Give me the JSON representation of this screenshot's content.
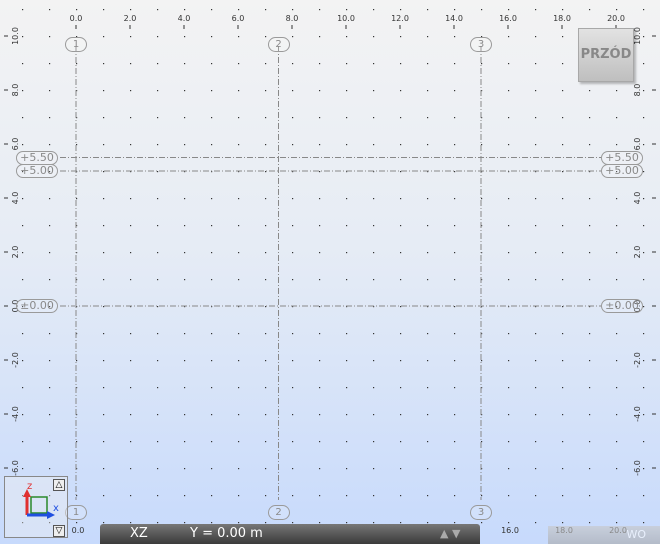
{
  "view": {
    "name": "PRZÓD",
    "plane": "XZ",
    "y_position": "Y = 0.00 m"
  },
  "ruler_top": [
    "0.0",
    "2.0",
    "4.0",
    "6.0",
    "8.0",
    "10.0",
    "12.0",
    "14.0",
    "16.0",
    "18.0",
    "20.0"
  ],
  "ruler_side": [
    "10.0",
    "8.0",
    "6.0",
    "4.0",
    "2.0",
    "0.0",
    "-2.0",
    "-4.0",
    "-6.0"
  ],
  "ruler_bottom": [
    "0.0",
    "16.0",
    "18.0",
    "20.0"
  ],
  "axes": [
    {
      "label": "1",
      "x": 0.0
    },
    {
      "label": "2",
      "x": 7.5
    },
    {
      "label": "3",
      "x": 15.0
    }
  ],
  "levels": [
    {
      "label": "+5.50",
      "z": 5.5
    },
    {
      "label": "+5.00",
      "z": 5.0
    },
    {
      "label": "±0.00",
      "z": 0.0
    }
  ],
  "triad": {
    "z": "z",
    "x": "x",
    "up": "△",
    "down": "▽"
  },
  "status_right_text": "WO",
  "colors": {
    "axis_line": "#888888",
    "triad_z": "#e03030",
    "triad_x": "#2050e0",
    "triad_box": "#2a8a2a"
  }
}
